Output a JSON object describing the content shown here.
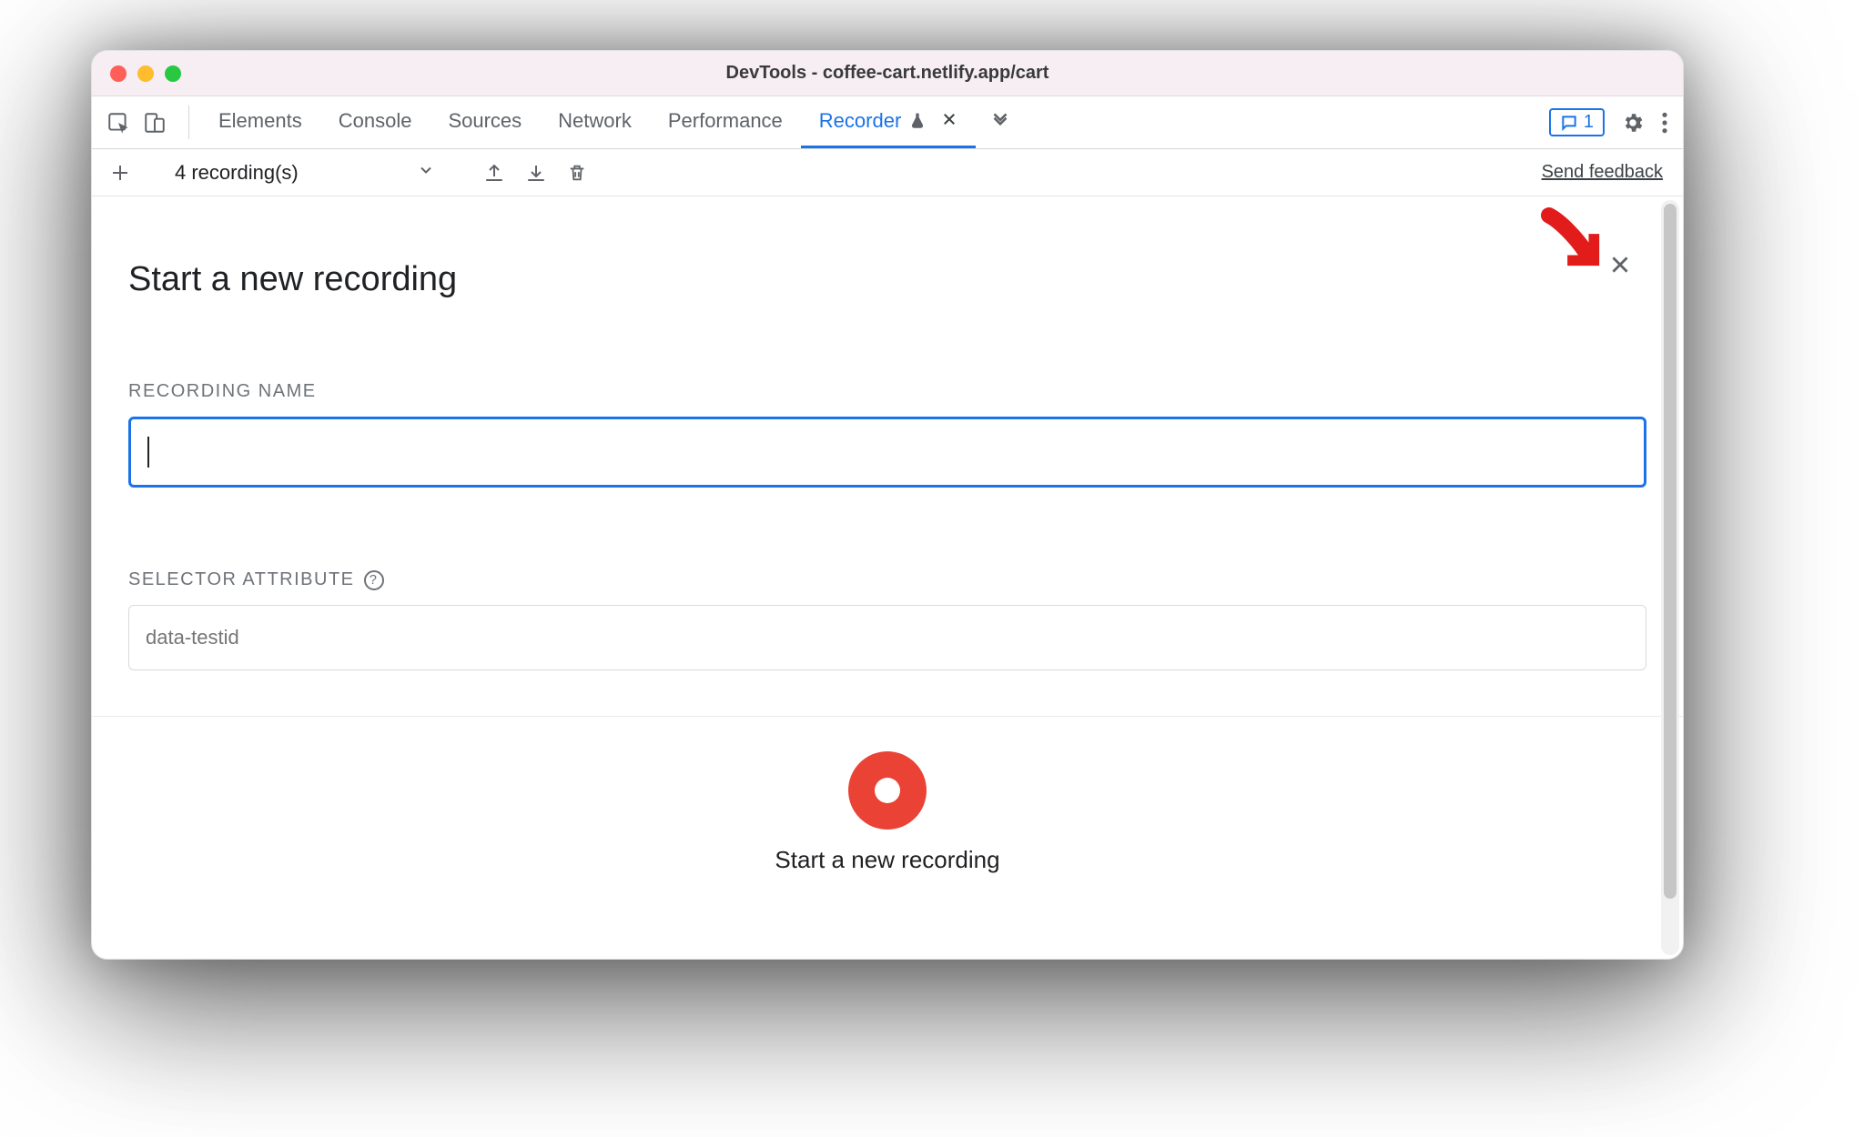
{
  "window": {
    "title": "DevTools - coffee-cart.netlify.app/cart"
  },
  "tabs": {
    "items": [
      {
        "label": "Elements"
      },
      {
        "label": "Console"
      },
      {
        "label": "Sources"
      },
      {
        "label": "Network"
      },
      {
        "label": "Performance"
      },
      {
        "label": "Recorder"
      }
    ],
    "active_index": 5
  },
  "issues_badge": {
    "count": "1"
  },
  "toolbar": {
    "dropdown_label": "4 recording(s)",
    "feedback_link": "Send feedback"
  },
  "panel": {
    "title": "Start a new recording",
    "recording_name_label": "RECORDING NAME",
    "recording_name_value": "",
    "selector_attr_label": "SELECTOR ATTRIBUTE",
    "selector_attr_placeholder": "data-testid",
    "start_caption": "Start a new recording"
  },
  "colors": {
    "accent": "#1a73e8",
    "record": "#ea4335",
    "arrow": "#e21b1b"
  }
}
